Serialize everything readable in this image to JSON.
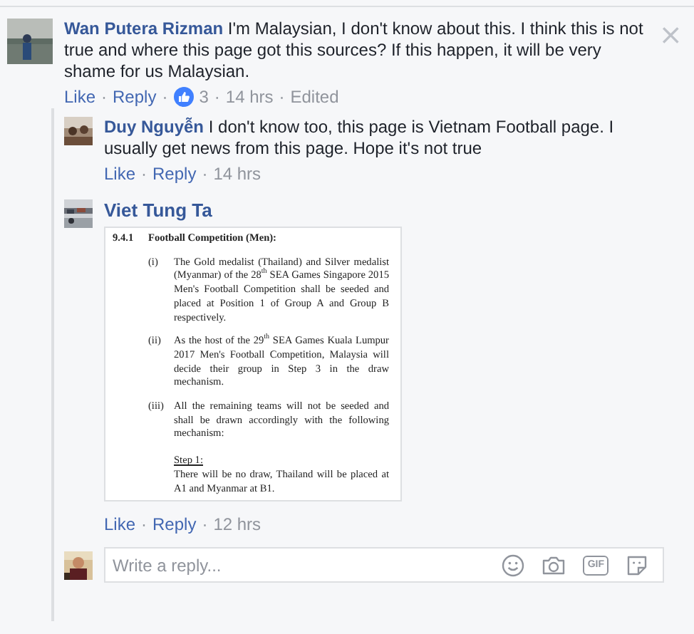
{
  "separator": "·",
  "comment": {
    "author": "Wan Putera Rizman",
    "text": "I'm Malaysian, I don't know about this. I think this is not true and where this page got this sources? If this happen, it will be very shame for us Malaysian.",
    "close": "×",
    "actions": [
      {
        "kind": "link",
        "text": "Like"
      },
      {
        "kind": "link",
        "text": "Reply"
      },
      {
        "kind": "reactions",
        "text": "3"
      },
      {
        "kind": "meta",
        "text": "14 hrs"
      },
      {
        "kind": "meta",
        "text": "Edited"
      }
    ]
  },
  "replies": [
    {
      "author": "Duy Nguyễn",
      "text": "I don't know too, this page is Vietnam Football page. I usually get news from this page. Hope it's not true",
      "actions": [
        {
          "kind": "link",
          "text": "Like"
        },
        {
          "kind": "link",
          "text": "Reply"
        },
        {
          "kind": "meta",
          "text": "14 hrs"
        }
      ]
    },
    {
      "author": "Viet Tung Ta",
      "attachment": {
        "number": "9.4.1",
        "heading": "Football Competition (Men):",
        "items": [
          {
            "marker": "(i)",
            "text": "The Gold medalist (Thailand) and Silver medalist (Myanmar) of the 28$^{th}$ SEA Games Singapore 2015 Men's Football Competition shall be seeded and placed at Position 1 of Group A and Group B respectively."
          },
          {
            "marker": "(ii)",
            "text": "As the host of the 29$^{th}$ SEA Games Kuala Lumpur 2017 Men's Football Competition, Malaysia will decide their group in Step 3 in the draw mechanism."
          },
          {
            "marker": "(iii)",
            "text": "All the remaining teams will not be seeded and shall be drawn accordingly with the following mechanism:",
            "step": {
              "heading": "Step 1:",
              "text": "There will be no draw, Thailand will be placed at A1 and Myanmar at B1."
            }
          }
        ]
      },
      "actions": [
        {
          "kind": "link",
          "text": "Like"
        },
        {
          "kind": "link",
          "text": "Reply"
        },
        {
          "kind": "meta",
          "text": "12 hrs"
        }
      ]
    }
  ],
  "reply_box": {
    "placeholder": "Write a reply...",
    "gif_label": "GIF"
  }
}
